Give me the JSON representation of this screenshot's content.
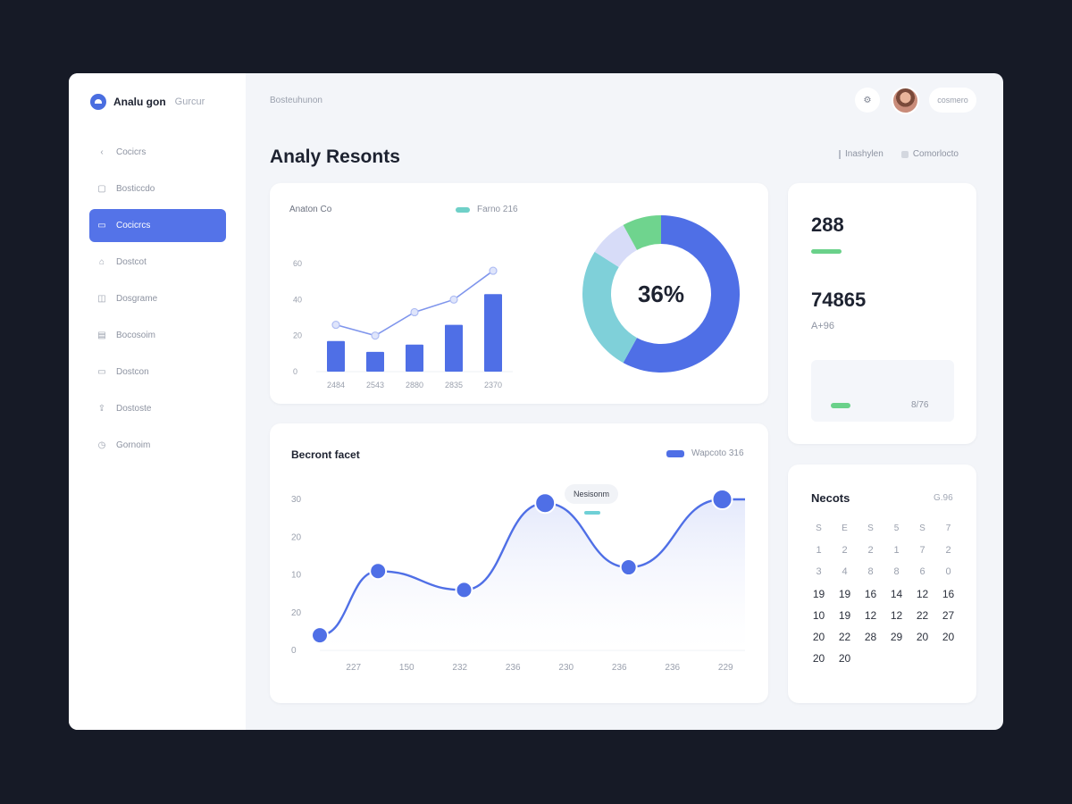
{
  "brand": {
    "name": "Analu gon",
    "sub": "Gurcur"
  },
  "nav": {
    "items": [
      {
        "label": "Cocicrs",
        "icon": "back-icon"
      },
      {
        "label": "Bosticcdo",
        "icon": "tag-icon"
      },
      {
        "label": "Cocicrcs",
        "icon": "chat-icon",
        "active": true
      },
      {
        "label": "Dostcot",
        "icon": "home-icon"
      },
      {
        "label": "Dosgrame",
        "icon": "camera-icon"
      },
      {
        "label": "Bocosoim",
        "icon": "calendar-icon"
      },
      {
        "label": "Dostcon",
        "icon": "card-icon"
      },
      {
        "label": "Dostoste",
        "icon": "upload-icon"
      },
      {
        "label": "Gornoim",
        "icon": "clock-icon"
      }
    ]
  },
  "topbar": {
    "breadcrumb": "Bosteuhunon",
    "icon_btn": "⚙",
    "user_label": "cosmero"
  },
  "page": {
    "title": "Analy Resonts",
    "filter_1": "Inashylen",
    "filter_2": "Comorlocto"
  },
  "card_a": {
    "title": "Anaton Co",
    "legend": "Farno 216"
  },
  "card_b": {
    "stat_1": "288",
    "stat_2": "74865",
    "stat_2_sub": "A+96",
    "mini_value": "8/76"
  },
  "card_c": {
    "title": "Becront facet",
    "legend": "Wapcoto 316",
    "tooltip": "Nesisonm"
  },
  "card_d": {
    "title": "Necots",
    "side": "G.96",
    "days": [
      "S",
      "E",
      "S",
      "5",
      "S",
      "7"
    ],
    "rows": [
      [
        "1",
        "2",
        "2",
        "1",
        "7",
        "2"
      ],
      [
        "3",
        "4",
        "8",
        "8",
        "6",
        "0"
      ],
      [
        "19",
        "19",
        "16",
        "14",
        "12",
        "16"
      ],
      [
        "10",
        "19",
        "12",
        "12",
        "22",
        "27"
      ],
      [
        "20",
        "22",
        "28",
        "29",
        "20",
        "20"
      ],
      [
        "20",
        "20",
        "",
        "",
        "",
        ""
      ]
    ]
  },
  "chart_data": [
    {
      "type": "bar",
      "title": "Anaton Co",
      "categories": [
        "2484",
        "2543",
        "2880",
        "2835",
        "2370"
      ],
      "values": [
        17,
        11,
        15,
        26,
        43
      ],
      "line_values": [
        26,
        20,
        33,
        40,
        56
      ],
      "y_ticks": [
        "0",
        "20",
        "40",
        "60"
      ],
      "ylim": [
        0,
        60
      ],
      "colors": {
        "bar": "#4f6fe6",
        "line": "#7f95ec"
      }
    },
    {
      "type": "pie",
      "center_label": "36%",
      "slices": [
        {
          "value": 58,
          "color": "#4f6fe6"
        },
        {
          "value": 26,
          "color": "#7fd0d9"
        },
        {
          "value": 8,
          "color": "#d7dcf8"
        },
        {
          "value": 8,
          "color": "#6fd48e"
        }
      ]
    },
    {
      "type": "area",
      "title": "Becront facet",
      "categories": [
        "227",
        "150",
        "232",
        "236",
        "230",
        "236",
        "236",
        "229"
      ],
      "points": [
        {
          "x": 0,
          "y": 4
        },
        {
          "x": 1.15,
          "y": 21
        },
        {
          "x": 2.85,
          "y": 16
        },
        {
          "x": 4.45,
          "y": 39
        },
        {
          "x": 6.1,
          "y": 22
        },
        {
          "x": 7.95,
          "y": 40
        }
      ],
      "end_point": {
        "x": 8.4,
        "y": 40
      },
      "y_ticks": [
        "0",
        "20",
        "10",
        "20",
        "30"
      ],
      "ylim": [
        0,
        40
      ],
      "xlim": [
        0,
        8.4
      ],
      "colors": {
        "line": "#4f6fe6",
        "fill": "#e4e9fb"
      }
    }
  ]
}
